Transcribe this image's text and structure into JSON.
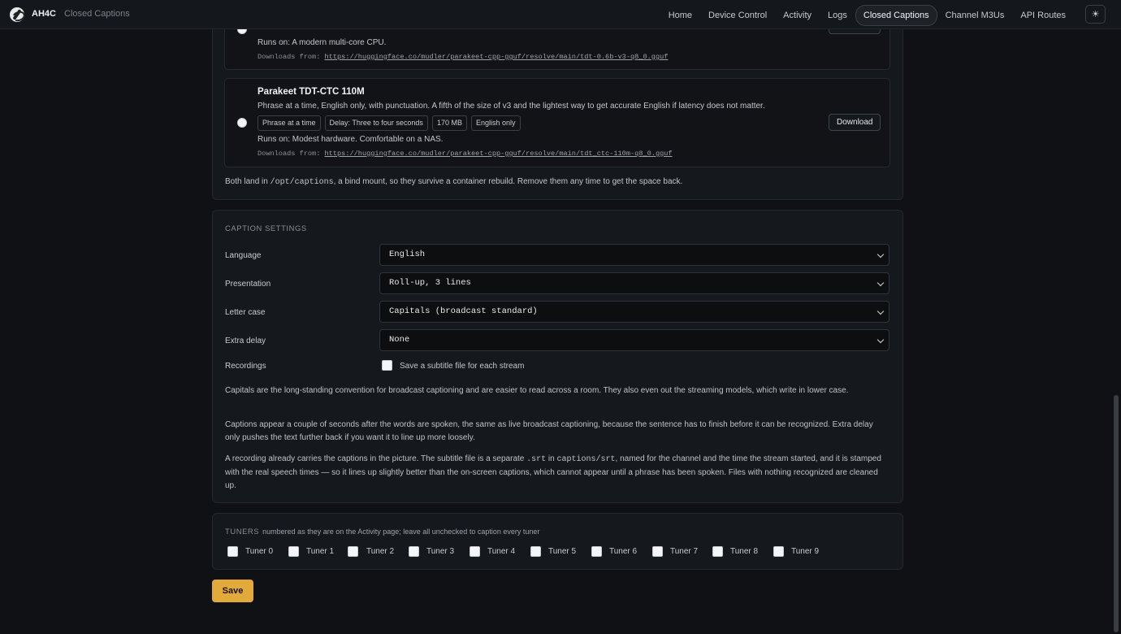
{
  "header": {
    "brand": "AH4C",
    "crumb": "Closed Captions",
    "nav": [
      "Home",
      "Device Control",
      "Activity",
      "Logs",
      "Closed Captions",
      "Channel M3Us",
      "API Routes"
    ],
    "active": "Closed Captions",
    "theme_icon": "sun-icon"
  },
  "models": {
    "top_runs_on": "Runs on: A modern multi-core CPU.",
    "top_downloads_prefix": "Downloads from:",
    "top_url": "https://huggingface.co/mudler/parakeet-cpp-gguf/resolve/main/tdt-0.6b-v3-q8_0.gguf",
    "card2": {
      "title": "Parakeet TDT-CTC 110M",
      "desc": "Phrase at a time, English only, with punctuation. A fifth of the size of v3 and the lightest way to get accurate English if latency does not matter.",
      "tags": [
        "Phrase at a time",
        "Delay: Three to four seconds",
        "170 MB",
        "English only"
      ],
      "runs_on": "Runs on: Modest hardware. Comfortable on a NAS.",
      "downloads_prefix": "Downloads from:",
      "url": "https://huggingface.co/mudler/parakeet-cpp-gguf/resolve/main/tdt_ctc-110m-q8_0.gguf",
      "button": "Download"
    },
    "note_a": "Both land in ",
    "note_path": "/opt/captions",
    "note_b": ", a bind mount, so they survive a container rebuild. Remove them any time to get the space back."
  },
  "settings": {
    "heading": "CAPTION SETTINGS",
    "language_label": "Language",
    "language_value": "English",
    "presentation_label": "Presentation",
    "presentation_value": "Roll-up, 3 lines",
    "lettercase_label": "Letter case",
    "lettercase_value": "Capitals (broadcast standard)",
    "delay_label": "Extra delay",
    "delay_value": "None",
    "recordings_label": "Recordings",
    "recordings_checkbox": "Save a subtitle file for each stream",
    "para1": "Capitals are the long-standing convention for broadcast captioning and are easier to read across a room. They also even out the streaming models, which write in lower case.",
    "para2": "Captions appear a couple of seconds after the words are spoken, the same as live broadcast captioning, because the sentence has to finish before it can be recognized. Extra delay only pushes the text further back if you want it to line up more loosely.",
    "para3_a": "A recording already carries the captions in the picture. The subtitle file is a separate ",
    "para3_code1": ".srt",
    "para3_b": " in ",
    "para3_code2": "captions/srt",
    "para3_c": ", named for the channel and the time the stream started, and it is stamped with the real speech times — so it lines up slightly better than the on-screen captions, which cannot appear until a phrase has been spoken. Files with nothing recognized are cleaned up."
  },
  "tuners": {
    "heading": "TUNERS",
    "sub": "numbered as they are on the Activity page; leave all unchecked to caption every tuner",
    "items": [
      "Tuner 0",
      "Tuner 1",
      "Tuner 2",
      "Tuner 3",
      "Tuner 4",
      "Tuner 5",
      "Tuner 6",
      "Tuner 7",
      "Tuner 8",
      "Tuner 9"
    ]
  },
  "save_label": "Save"
}
